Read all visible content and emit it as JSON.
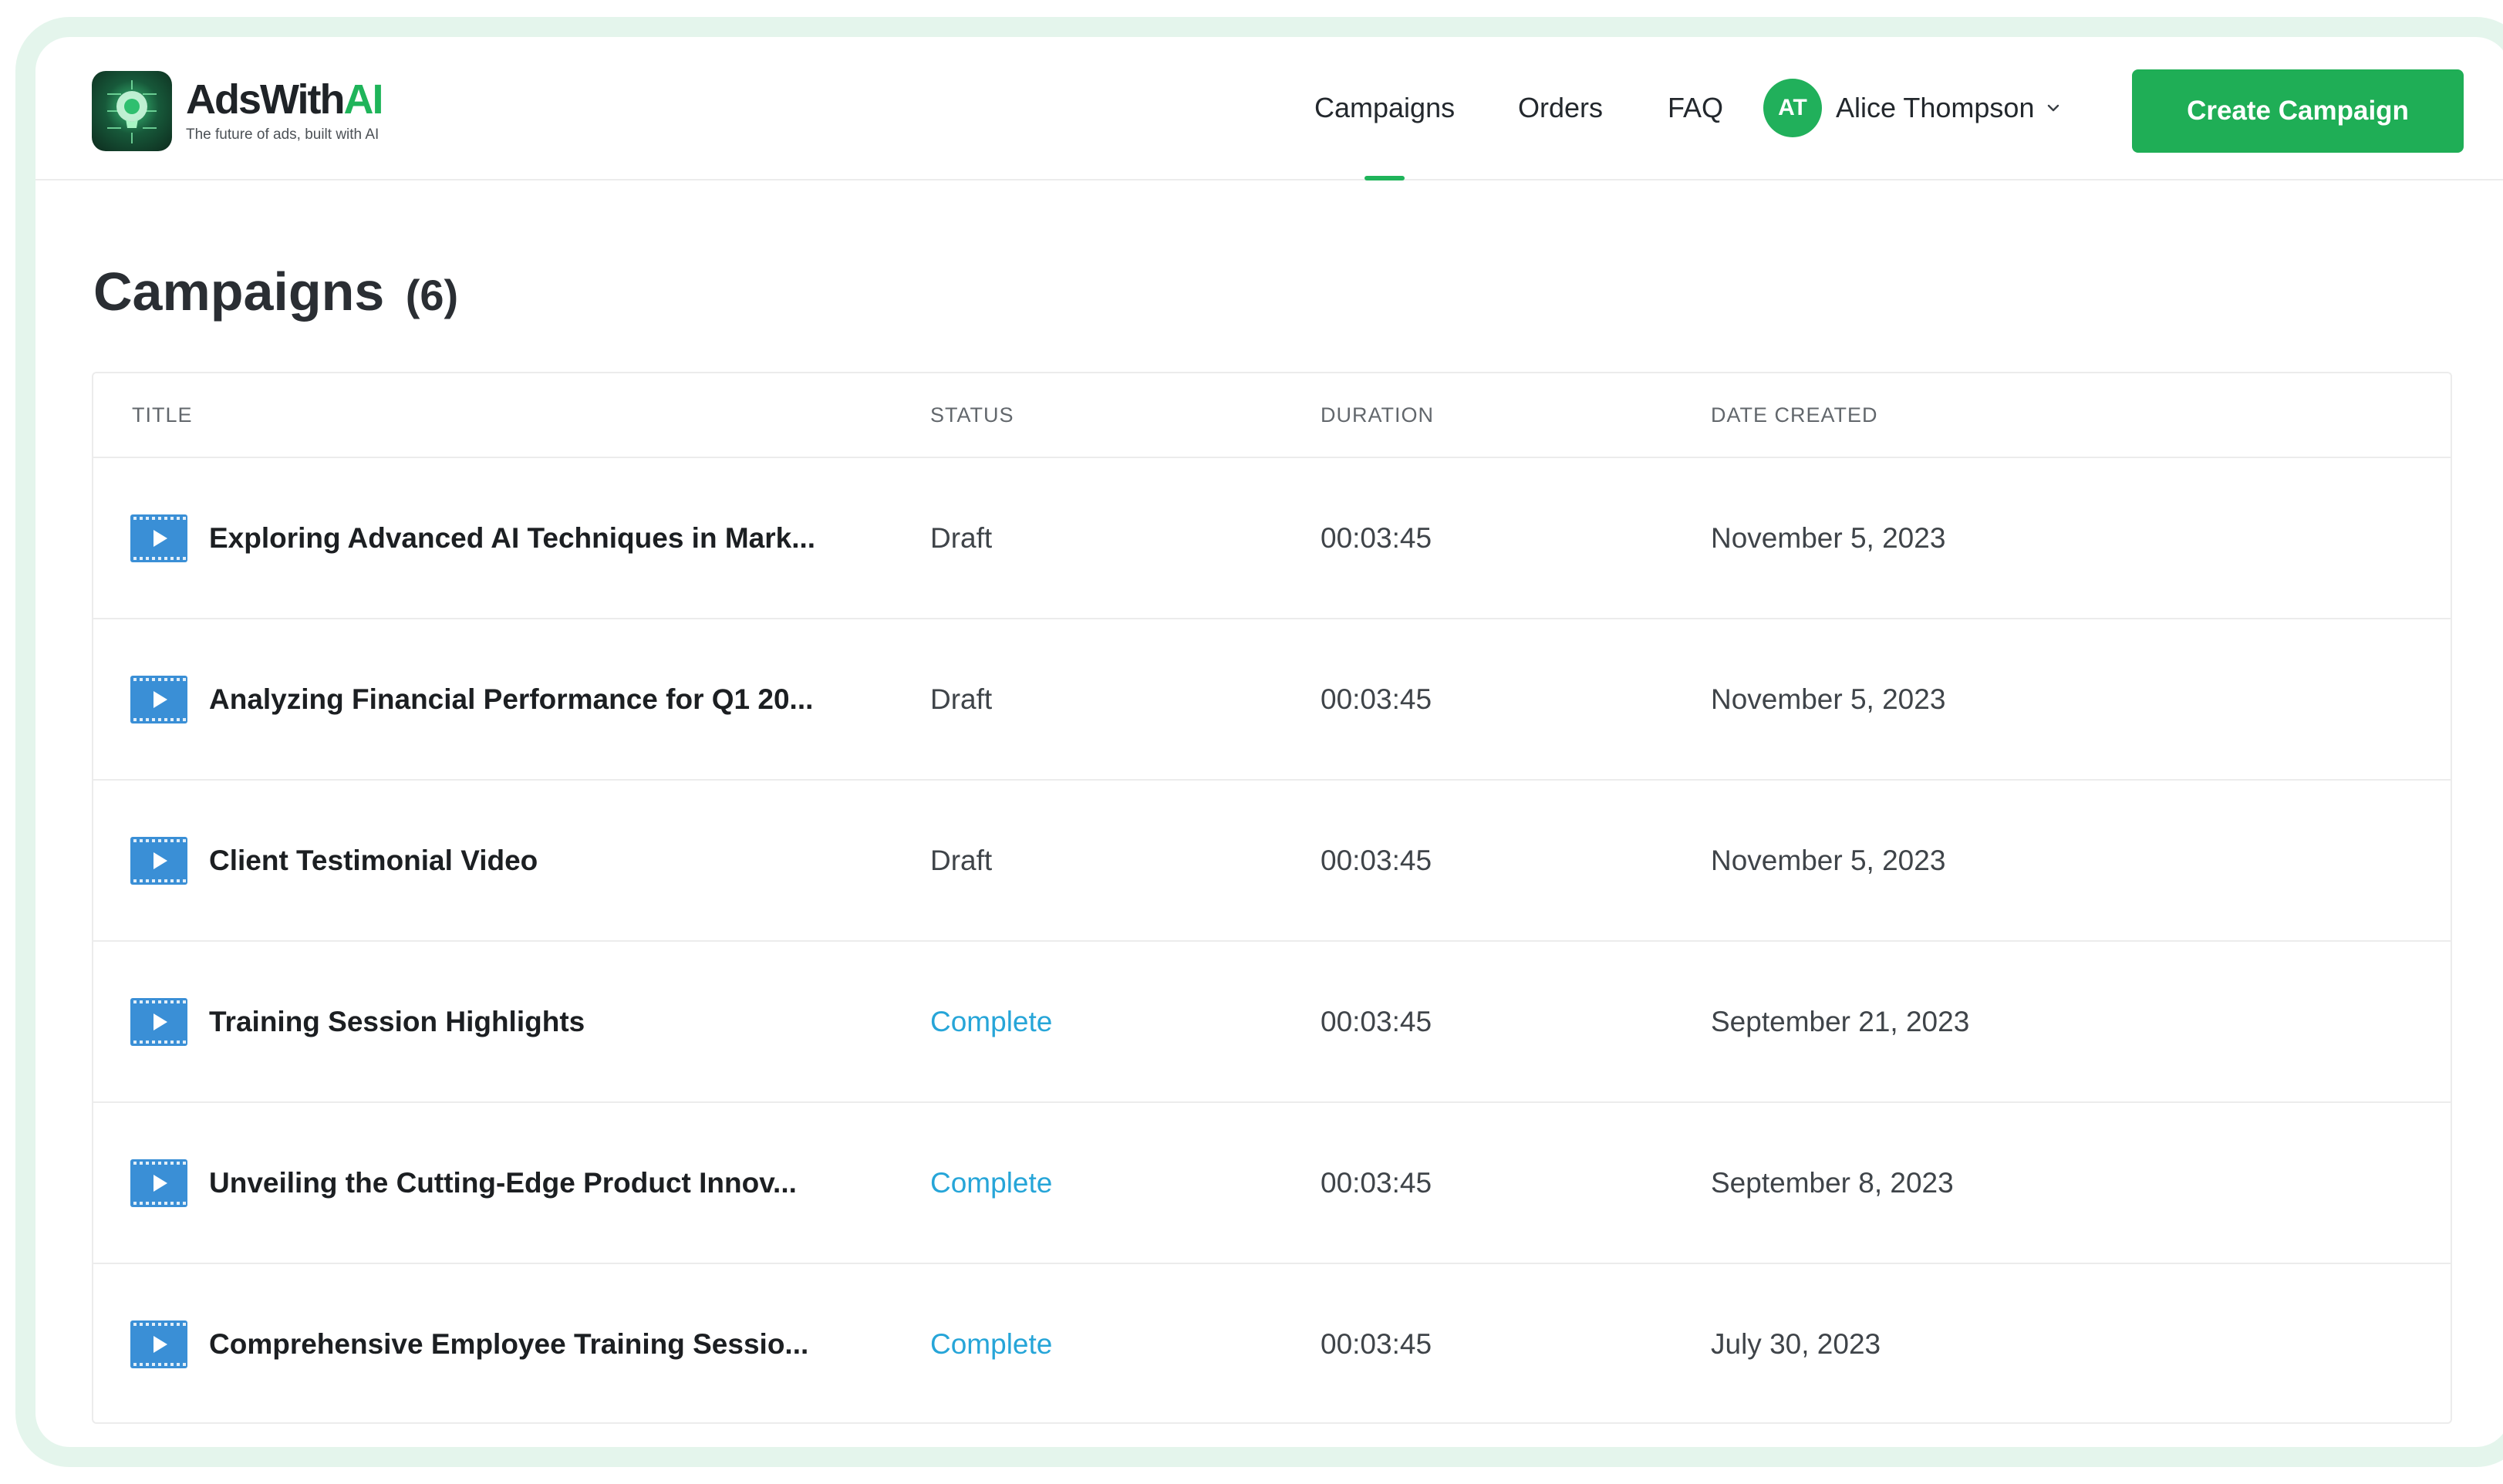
{
  "brand": {
    "name_part1": "AdsWith",
    "name_part2": "AI",
    "tagline": "The future of ads, built with AI"
  },
  "nav": {
    "items": [
      {
        "label": "Campaigns",
        "active": true
      },
      {
        "label": "Orders",
        "active": false
      },
      {
        "label": "FAQ",
        "active": false
      }
    ]
  },
  "user": {
    "initials": "AT",
    "name": "Alice Thompson"
  },
  "actions": {
    "create_label": "Create Campaign"
  },
  "page": {
    "title": "Campaigns",
    "count": "(6)"
  },
  "table": {
    "columns": [
      "TITLE",
      "STATUS",
      "DURATION",
      "DATE CREATED"
    ],
    "rows": [
      {
        "title": "Exploring Advanced AI Techniques in Mark...",
        "status": "Draft",
        "duration": "00:03:45",
        "date": "November 5, 2023"
      },
      {
        "title": "Analyzing Financial Performance for Q1 20...",
        "status": "Draft",
        "duration": "00:03:45",
        "date": "November 5, 2023"
      },
      {
        "title": "Client Testimonial Video",
        "status": "Draft",
        "duration": "00:03:45",
        "date": "November 5, 2023"
      },
      {
        "title": "Training Session Highlights",
        "status": "Complete",
        "duration": "00:03:45",
        "date": "September 21, 2023"
      },
      {
        "title": "Unveiling the Cutting-Edge Product Innov...",
        "status": "Complete",
        "duration": "00:03:45",
        "date": "September 8, 2023"
      },
      {
        "title": "Comprehensive Employee Training Sessio...",
        "status": "Complete",
        "duration": "00:03:45",
        "date": "July 30, 2023"
      }
    ]
  },
  "icons": {
    "row_icon": "video-icon",
    "user_menu": "chevron-down-icon",
    "logo": "brain-chip-icon"
  },
  "colors": {
    "accent": "#1fb45a",
    "button": "#1fae56",
    "complete": "#26a5d8",
    "video_icon": "#3a8fd6",
    "frame": "#e4f5ec"
  }
}
